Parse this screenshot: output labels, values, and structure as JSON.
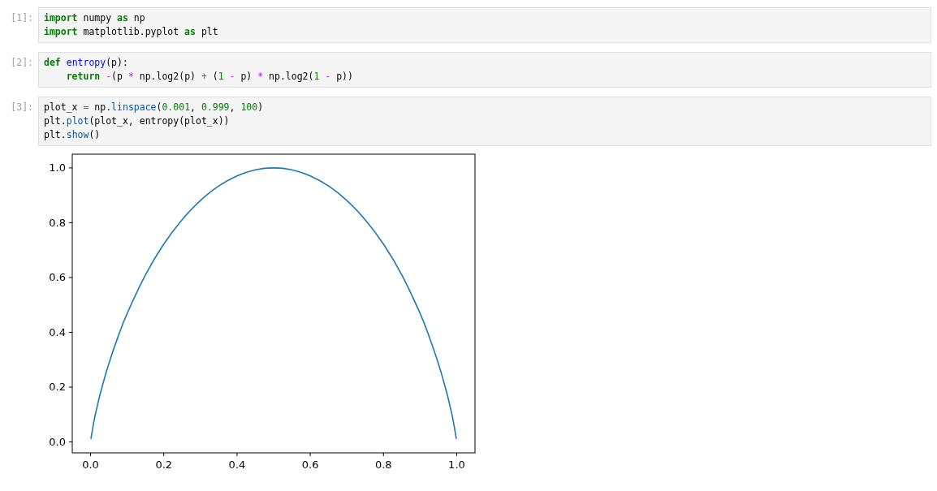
{
  "cells": [
    {
      "prompt": "[1]:",
      "lines": [
        [
          {
            "text": "import",
            "kind": "keyword"
          },
          {
            "text": " numpy ",
            "kind": "plain"
          },
          {
            "text": "as",
            "kind": "keyword"
          },
          {
            "text": " np",
            "kind": "plain"
          }
        ],
        [
          {
            "text": "import",
            "kind": "keyword"
          },
          {
            "text": " matplotlib.pyplot ",
            "kind": "plain"
          },
          {
            "text": "as",
            "kind": "keyword"
          },
          {
            "text": " plt",
            "kind": "plain"
          }
        ]
      ]
    },
    {
      "prompt": "[2]:",
      "lines": [
        [
          {
            "text": "def",
            "kind": "keyword"
          },
          {
            "text": " entropy",
            "kind": "defname"
          },
          {
            "text": "(p):",
            "kind": "plain"
          }
        ],
        [
          {
            "text": "    return",
            "kind": "keyword"
          },
          {
            "text": " -",
            "kind": "operator"
          },
          {
            "text": "(p ",
            "kind": "plain"
          },
          {
            "text": "*",
            "kind": "operator"
          },
          {
            "text": " np.log2(p) ",
            "kind": "plain"
          },
          {
            "text": "+",
            "kind": "operator"
          },
          {
            "text": " (",
            "kind": "plain"
          },
          {
            "text": "1",
            "kind": "number"
          },
          {
            "text": " -",
            "kind": "operator"
          },
          {
            "text": " p) ",
            "kind": "plain"
          },
          {
            "text": "*",
            "kind": "operator"
          },
          {
            "text": " np.log2(",
            "kind": "plain"
          },
          {
            "text": "1",
            "kind": "number"
          },
          {
            "text": " -",
            "kind": "operator"
          },
          {
            "text": " p))",
            "kind": "plain"
          }
        ]
      ]
    },
    {
      "prompt": "[3]:",
      "lines": [
        [
          {
            "text": "plot_x ",
            "kind": "plain"
          },
          {
            "text": "=",
            "kind": "operator"
          },
          {
            "text": " np.",
            "kind": "plain"
          },
          {
            "text": "linspace",
            "kind": "attribute"
          },
          {
            "text": "(",
            "kind": "plain"
          },
          {
            "text": "0.001",
            "kind": "number"
          },
          {
            "text": ", ",
            "kind": "plain"
          },
          {
            "text": "0.999",
            "kind": "number"
          },
          {
            "text": ", ",
            "kind": "plain"
          },
          {
            "text": "100",
            "kind": "number"
          },
          {
            "text": ")",
            "kind": "plain"
          }
        ],
        [
          {
            "text": "plt.",
            "kind": "plain"
          },
          {
            "text": "plot",
            "kind": "attribute"
          },
          {
            "text": "(plot_x, entropy(plot_x))",
            "kind": "plain"
          }
        ],
        [
          {
            "text": "plt.",
            "kind": "plain"
          },
          {
            "text": "show",
            "kind": "attribute"
          },
          {
            "text": "()",
            "kind": "plain"
          }
        ]
      ],
      "output": {
        "chart_data": {
          "type": "line",
          "x": [
            0.001,
            0.01,
            0.02,
            0.03,
            0.05,
            0.075,
            0.1,
            0.15,
            0.2,
            0.25,
            0.3,
            0.35,
            0.4,
            0.45,
            0.5,
            0.55,
            0.6,
            0.65,
            0.7,
            0.75,
            0.8,
            0.85,
            0.9,
            0.925,
            0.95,
            0.97,
            0.98,
            0.99,
            0.999
          ],
          "series": [
            {
              "color": "#1f77b4",
              "values": [
                0.011,
                0.081,
                0.141,
                0.194,
                0.286,
                0.384,
                0.469,
                0.61,
                0.722,
                0.811,
                0.881,
                0.934,
                0.971,
                0.993,
                1.0,
                0.993,
                0.971,
                0.934,
                0.881,
                0.811,
                0.722,
                0.61,
                0.469,
                0.384,
                0.286,
                0.194,
                0.141,
                0.081,
                0.011
              ]
            }
          ],
          "xlim": [
            -0.05,
            1.05
          ],
          "ylim": [
            -0.04,
            1.05
          ],
          "xticks": [
            {
              "value": 0,
              "label": "0.0"
            },
            {
              "value": 0.2,
              "label": "0.2"
            },
            {
              "value": 0.4,
              "label": "0.4"
            },
            {
              "value": 0.6,
              "label": "0.6"
            },
            {
              "value": 0.8,
              "label": "0.8"
            },
            {
              "value": 1,
              "label": "1.0"
            }
          ],
          "yticks": [
            {
              "value": 0,
              "label": "0.0"
            },
            {
              "value": 0.2,
              "label": "0.2"
            },
            {
              "value": 0.4,
              "label": "0.4"
            },
            {
              "value": 0.6,
              "label": "0.6"
            },
            {
              "value": 0.8,
              "label": "0.8"
            },
            {
              "value": 1,
              "label": "1.0"
            }
          ]
        }
      }
    }
  ]
}
